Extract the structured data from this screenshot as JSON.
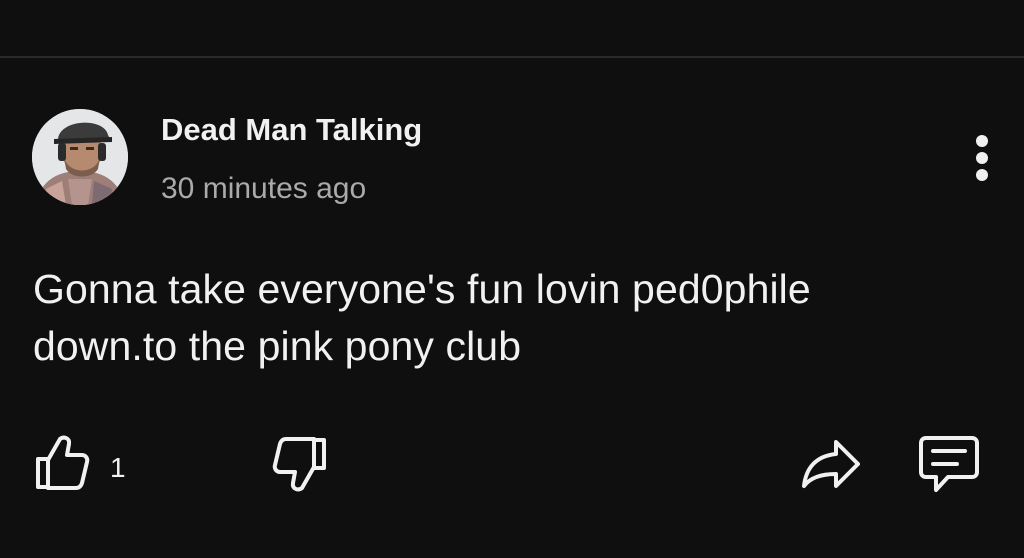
{
  "post": {
    "author": "Dead Man Talking",
    "timestamp": "30 minutes ago",
    "body_line1": "Gonna take everyone's fun lovin ped0phile",
    "body_line2": "down.to the pink pony club",
    "like_count": "1"
  },
  "icons": {
    "more": "vertical-ellipsis-icon",
    "like": "thumbs-up-icon",
    "dislike": "thumbs-down-icon",
    "share": "share-arrow-icon",
    "reply": "comment-bubble-icon"
  },
  "colors": {
    "background": "#0f0f0f",
    "text_primary": "#f1f1f1",
    "text_secondary": "#aaaaaa",
    "divider": "#2a2a2a"
  }
}
